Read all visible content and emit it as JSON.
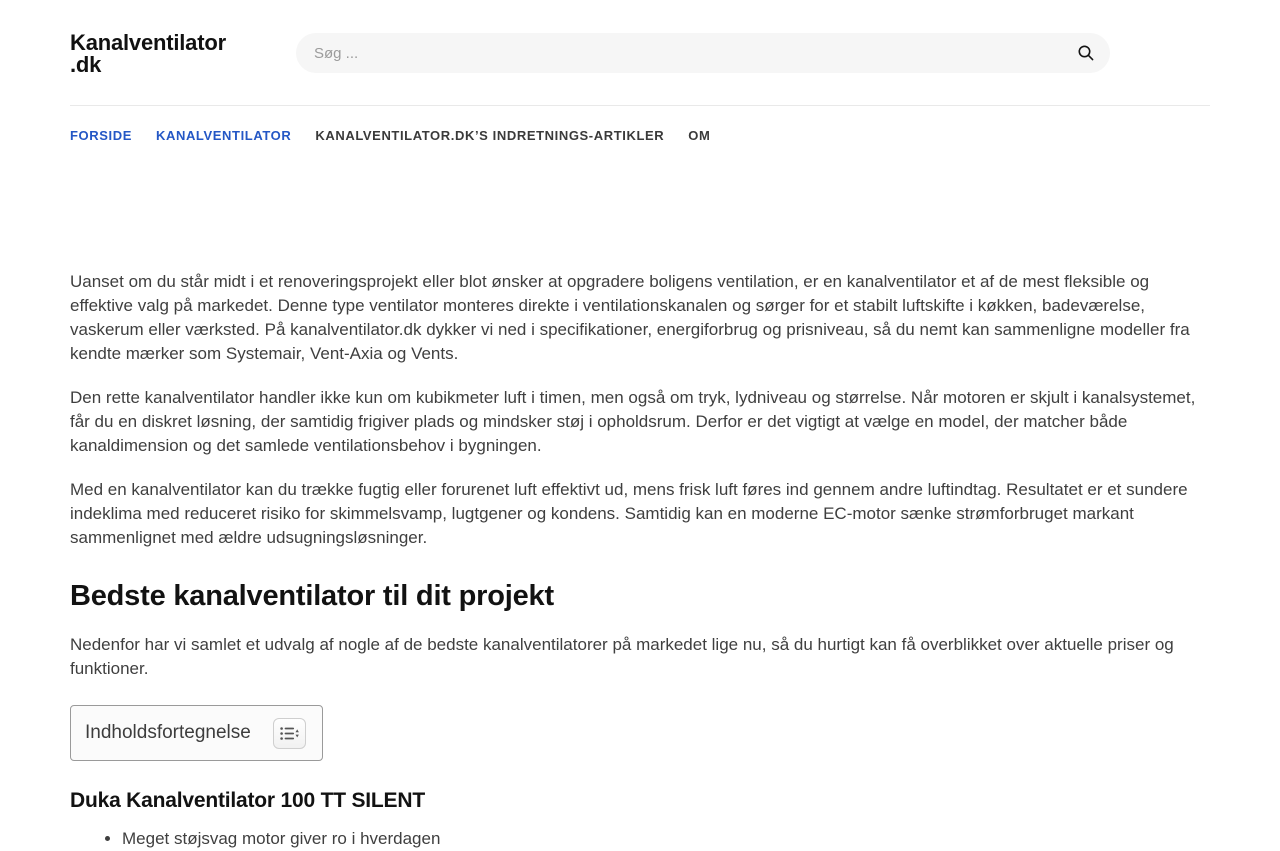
{
  "colors": {
    "accent_blue": "#2457c5",
    "body_text": "#3f3f3f",
    "heading_text": "#121212",
    "search_background": "#f6f6f6",
    "divider": "#e9e9e9",
    "toc_border": "#9a9a9a"
  },
  "header": {
    "logo_text": "Kanalventilator\n.dk",
    "search": {
      "placeholder": "Søg ...",
      "icon": "search-icon"
    }
  },
  "nav": {
    "items": [
      {
        "label": "FORSIDE",
        "active": true
      },
      {
        "label": "KANALVENTILATOR",
        "active": true
      },
      {
        "label": "KANALVENTILATOR.DK’S INDRETNINGS-ARTIKLER",
        "active": false
      },
      {
        "label": "OM",
        "active": false
      }
    ]
  },
  "article": {
    "intro_paragraphs": [
      "Uanset om du står midt i et renoveringsprojekt eller blot ønsker at opgradere boligens ventilation, er en kanalventilator et af de mest fleksible og effektive valg på markedet. Denne type ventilator monteres direkte i ventilationskanalen og sørger for et stabilt luftskifte i køkken, badeværelse, vaskerum eller værksted. På kanalventilator.dk dykker vi ned i specifikationer, energiforbrug og prisniveau, så du nemt kan sammenligne modeller fra kendte mærker som Systemair, Vent-Axia og Vents.",
      "Den rette kanalventilator handler ikke kun om kubikmeter luft i timen, men også om tryk, lydniveau og størrelse. Når motoren er skjult i kanalsystemet, får du en diskret løsning, der samtidig frigiver plads og mindsker støj i opholdsrum. Derfor er det vigtigt at vælge en model, der matcher både kanaldimension og det samlede ventilationsbehov i bygningen.",
      "Med en kanalventilator kan du trække fugtig eller forurenet luft effektivt ud, mens frisk luft føres ind gennem andre luftindtag. Resultatet er et sundere indeklima med reduceret risiko for skimmelsvamp, lugtgener og kondens. Samtidig kan en moderne EC-motor sænke strømforbruget markant sammenlignet med ældre udsugningsløsninger."
    ],
    "section_heading": "Bedste kanalventilator til dit projekt",
    "section_intro": "Nedenfor har vi samlet et udvalg af nogle af de bedste kanalventilatorer på markedet lige nu, så du hurtigt kan få overblikket over aktuelle priser og funktioner.",
    "toc": {
      "title": "Indholdsfortegnelse",
      "toggle_icon": "toc-toggle-icon"
    },
    "product_heading": "Duka Kanalventilator 100 TT SILENT",
    "product_bullets": [
      "Meget støjsvag motor giver ro i hverdagen"
    ]
  }
}
